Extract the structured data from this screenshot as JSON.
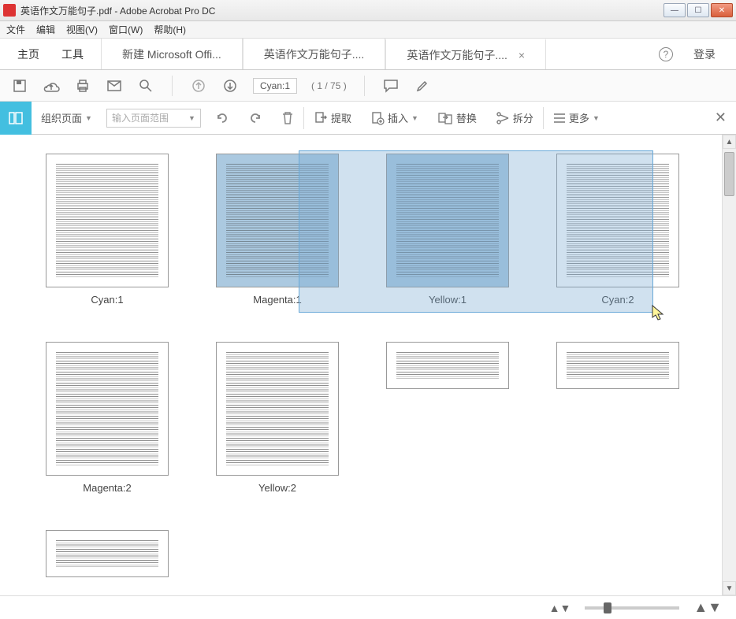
{
  "window": {
    "title": "英语作文万能句子.pdf - Adobe Acrobat Pro DC"
  },
  "menu": {
    "file": "文件",
    "edit": "编辑",
    "view": "视图(V)",
    "window": "窗口(W)",
    "help": "帮助(H)"
  },
  "tabs": {
    "home": "主页",
    "tools": "工具",
    "tab1": "新建 Microsoft Offi...",
    "tab2": "英语作文万能句子....",
    "tab3": "英语作文万能句子....",
    "login": "登录"
  },
  "toolbar1": {
    "page_indicator": "Cyan:1",
    "page_count": "( 1 / 75 )"
  },
  "toolbar2": {
    "organize": "组织页面",
    "range_placeholder": "输入页面范围",
    "extract": "提取",
    "insert": "插入",
    "replace": "替换",
    "split": "拆分",
    "more": "更多"
  },
  "thumbnails": {
    "row1": [
      "Cyan:1",
      "Magenta:1",
      "Yellow:1"
    ],
    "row2": [
      "Cyan:2",
      "Magenta:2",
      "Yellow:2"
    ]
  }
}
